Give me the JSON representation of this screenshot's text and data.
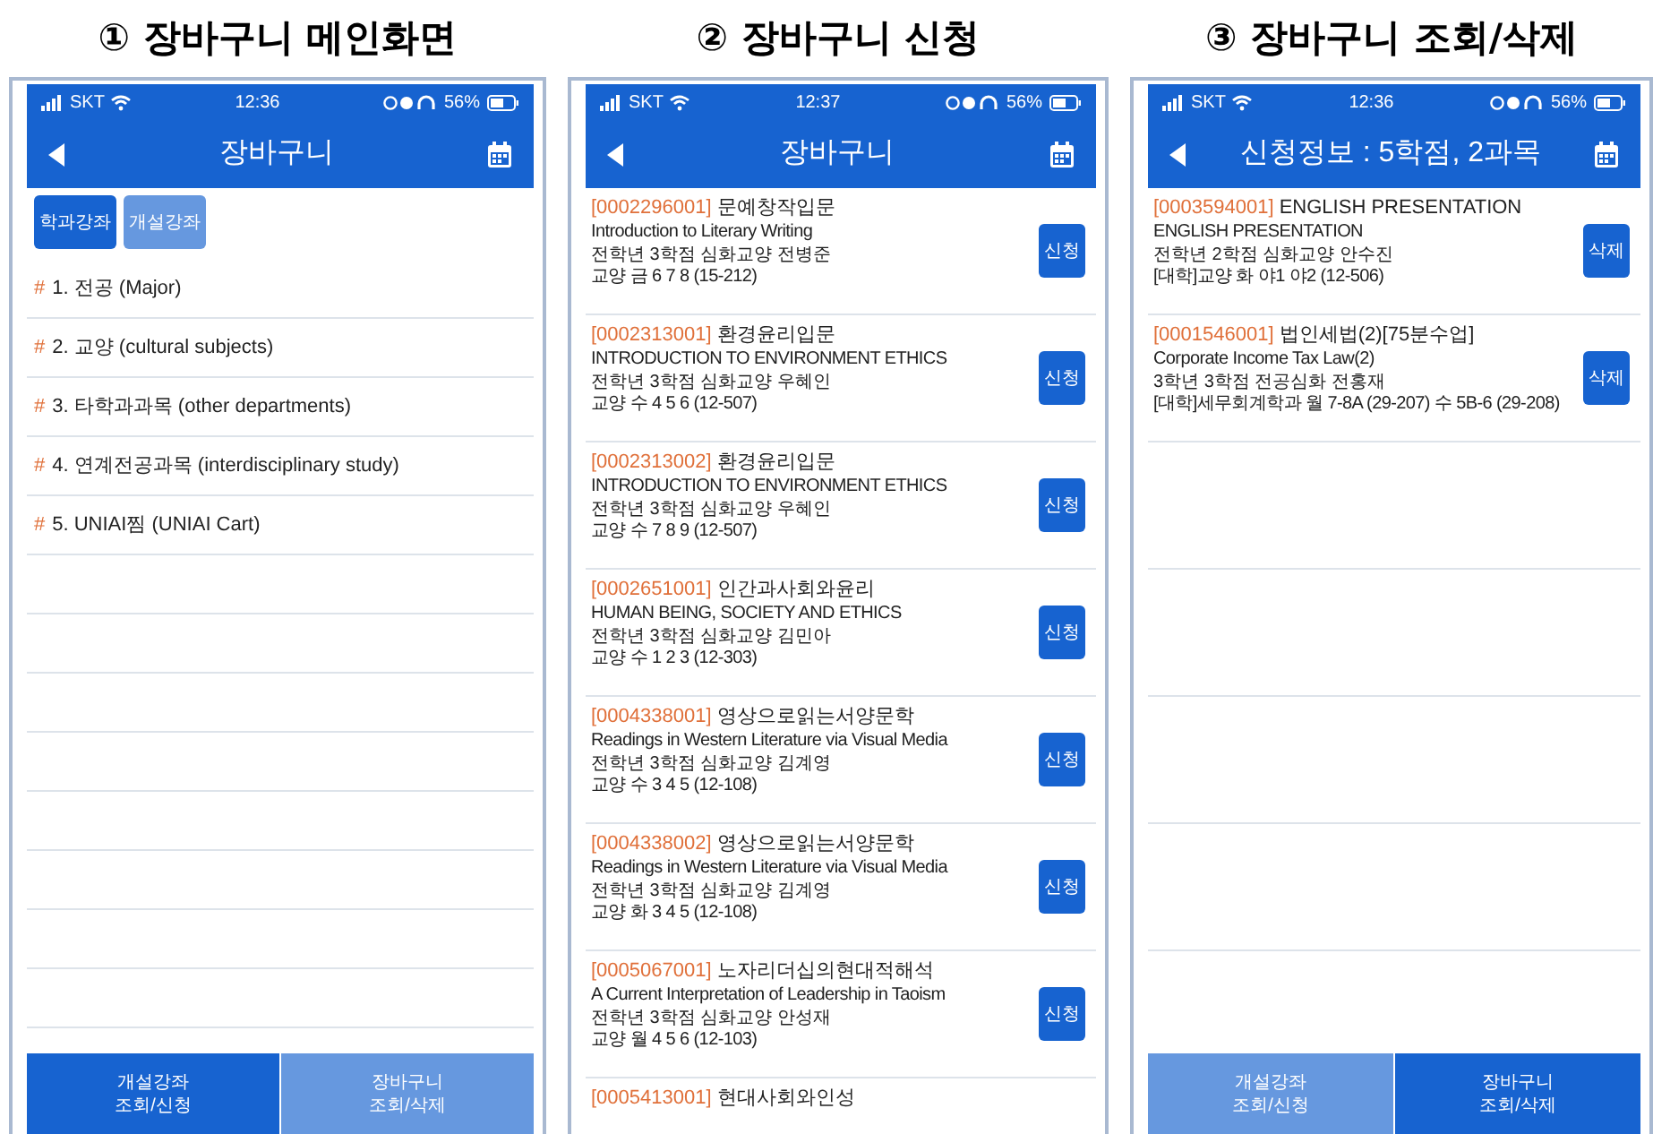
{
  "panels": [
    {
      "kind": "menu",
      "caption": "① 장바구니 메인화면",
      "status": {
        "carrier": "SKT",
        "time": "12:36",
        "battery": "56%"
      },
      "header": {
        "title": "장바구니"
      },
      "toggles": [
        {
          "label": "학과강좌",
          "selected": true
        },
        {
          "label": "개설강좌",
          "selected": false
        }
      ],
      "menu_items": [
        {
          "marker": "#",
          "label": "1. 전공 (Major)"
        },
        {
          "marker": "#",
          "label": "2. 교양 (cultural subjects)"
        },
        {
          "marker": "#",
          "label": "3. 타학과과목 (other departments)"
        },
        {
          "marker": "#",
          "label": "4. 연계전공과목 (interdisciplinary study)"
        },
        {
          "marker": "#",
          "label": "5. UNIAI찜 (UNIAI Cart)"
        }
      ],
      "bottom_tabs": [
        {
          "lines": [
            "개설강좌",
            "조회/신청"
          ],
          "selected": true
        },
        {
          "lines": [
            "장바구니",
            "조회/삭제"
          ],
          "selected": false
        }
      ]
    },
    {
      "kind": "courses",
      "caption": "② 장바구니 신청",
      "status": {
        "carrier": "SKT",
        "time": "12:37",
        "battery": "56%"
      },
      "header": {
        "title": "장바구니"
      },
      "courses": [
        {
          "code": "[0002296001]",
          "name": "문예창작입문",
          "english": "Introduction to Literary Writing",
          "info": "전학년 3학점 심화교양 전병준",
          "schedule": "교양 금 6  7  8 (15-212)",
          "button": "신청"
        },
        {
          "code": "[0002313001]",
          "name": "환경윤리입문",
          "english": "INTRODUCTION TO ENVIRONMENT ETHICS",
          "info": "전학년 3학점 심화교양 우혜인",
          "schedule": "교양 수 4  5  6 (12-507)",
          "button": "신청"
        },
        {
          "code": "[0002313002]",
          "name": "환경윤리입문",
          "english": "INTRODUCTION TO ENVIRONMENT ETHICS",
          "info": "전학년 3학점 심화교양 우혜인",
          "schedule": "교양 수 7  8  9 (12-507)",
          "button": "신청"
        },
        {
          "code": "[0002651001]",
          "name": "인간과사회와윤리",
          "english": "HUMAN BEING, SOCIETY AND ETHICS",
          "info": "전학년 3학점 심화교양 김민아",
          "schedule": "교양 수 1  2  3 (12-303)",
          "button": "신청"
        },
        {
          "code": "[0004338001]",
          "name": "영상으로읽는서양문학",
          "english": "Readings in Western Literature via Visual Media",
          "info": "전학년 3학점 심화교양 김계영",
          "schedule": "교양 수 3  4  5 (12-108)",
          "button": "신청"
        },
        {
          "code": "[0004338002]",
          "name": "영상으로읽는서양문학",
          "english": "Readings in Western Literature via Visual Media",
          "info": "전학년 3학점 심화교양 김계영",
          "schedule": "교양 화 3  4  5 (12-108)",
          "button": "신청"
        },
        {
          "code": "[0005067001]",
          "name": "노자리더십의현대적해석",
          "english": "A Current Interpretation of Leadership in Taoism",
          "info": "전학년 3학점 심화교양 안성재",
          "schedule": "교양 월 4  5  6 (12-103)",
          "button": "신청"
        },
        {
          "code": "[0005413001]",
          "name": "현대사회와인성"
        }
      ]
    },
    {
      "kind": "courses",
      "caption": "③ 장바구니 조회/삭제",
      "status": {
        "carrier": "SKT",
        "time": "12:36",
        "battery": "56%"
      },
      "header": {
        "title": "신청정보 : 5학점,  2과목"
      },
      "courses": [
        {
          "code": "[0003594001]",
          "name": "ENGLISH PRESENTATION",
          "english": "ENGLISH PRESENTATION",
          "info": "전학년 2학점 심화교양 안수진",
          "schedule": "[대학]교양 화 야1  야2 (12-506)",
          "button": "삭제"
        },
        {
          "code": "[0001546001]",
          "name": "법인세법(2)[75분수업]",
          "english": "Corporate Income Tax Law(2)",
          "info": "3학년 3학점 전공심화 전홍재",
          "schedule": "[대학]세무회계학과 월 7-8A (29-207) 수 5B-6 (29-208)",
          "button": "삭제"
        }
      ],
      "bottom_tabs": [
        {
          "lines": [
            "개설강좌",
            "조회/신청"
          ],
          "selected": false
        },
        {
          "lines": [
            "장바구니",
            "조회/삭제"
          ],
          "selected": true
        }
      ]
    }
  ]
}
